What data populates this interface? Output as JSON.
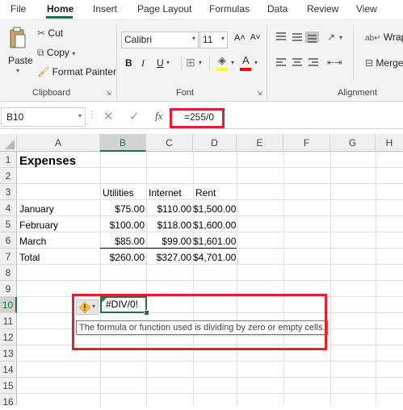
{
  "tabs": [
    "File",
    "Home",
    "Insert",
    "Page Layout",
    "Formulas",
    "Data",
    "Review",
    "View"
  ],
  "clipboard": {
    "paste": "Paste",
    "cut": "Cut",
    "copy": "Copy",
    "format_painter": "Format Painter",
    "label": "Clipboard"
  },
  "font": {
    "name": "Calibri",
    "size": "11",
    "grow": "A˄",
    "shrink": "A˅",
    "bold": "B",
    "italic": "I",
    "underline": "U",
    "font_color_glyph": "A",
    "label": "Font"
  },
  "alignment": {
    "wrap": "Wrap",
    "merge": "Merge",
    "label": "Alignment"
  },
  "formula_bar": {
    "name_box": "B10",
    "fx": "fx",
    "formula": "=255/0"
  },
  "columns": [
    "A",
    "B",
    "C",
    "D",
    "E",
    "F",
    "G",
    "H"
  ],
  "rows": [
    "1",
    "2",
    "3",
    "4",
    "5",
    "6",
    "7",
    "8",
    "9",
    "10",
    "11",
    "12",
    "13",
    "14",
    "15",
    "16"
  ],
  "sheet": {
    "title": "Expenses",
    "headers": [
      "Utilities",
      "Internet",
      "Rent"
    ],
    "data": [
      {
        "label": "January",
        "values": [
          "$75.00",
          "$110.00",
          "$1,500.00"
        ]
      },
      {
        "label": "February",
        "values": [
          "$100.00",
          "$118.00",
          "$1,600.00"
        ]
      },
      {
        "label": "March",
        "values": [
          "$85.00",
          "$99.00",
          "$1,601.00"
        ]
      },
      {
        "label": "Total",
        "values": [
          "$260.00",
          "$327.00",
          "$4,701.00"
        ]
      }
    ],
    "error_value": "#DIV/0!",
    "error_tooltip": "The formula or function used is dividing by zero or empty cells."
  },
  "colors": {
    "accent_green": "#217346",
    "highlight_red": "#e0202a",
    "fill_yellow": "#ffff00",
    "font_red": "#ff0000"
  }
}
